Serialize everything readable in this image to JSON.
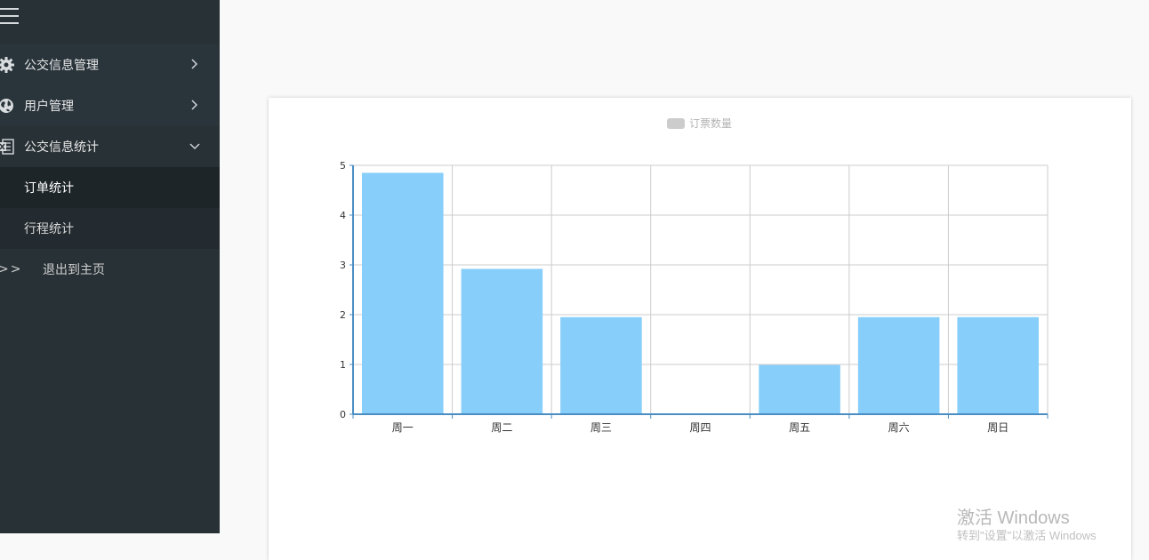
{
  "sidebar": {
    "items": [
      {
        "label": "公交信息管理",
        "icon": "gear-icon",
        "state": "collapsed"
      },
      {
        "label": "用户管理",
        "icon": "globe-icon",
        "state": "collapsed"
      },
      {
        "label": "公交信息统计",
        "icon": "excel-icon",
        "state": "expanded"
      }
    ],
    "sub_items": [
      {
        "label": "订单统计",
        "active": true
      },
      {
        "label": "行程统计",
        "active": false
      }
    ],
    "exit": {
      "arrows": ">>",
      "label": "退出到主页"
    }
  },
  "colors": {
    "sidebar_bg": "#283136",
    "bar": "#87cefa",
    "axis": "#4a8ec4"
  },
  "chart_data": {
    "type": "bar",
    "legend": [
      "订票数量"
    ],
    "categories": [
      "周一",
      "周二",
      "周三",
      "周四",
      "周五",
      "周六",
      "周日"
    ],
    "series": [
      {
        "name": "订票数量",
        "values": [
          4.85,
          2.92,
          1.95,
          0,
          0.99,
          1.95,
          1.95
        ]
      }
    ],
    "ylim": [
      0,
      5
    ],
    "yticks": [
      "0",
      "1",
      "2",
      "3",
      "4",
      "5"
    ],
    "grid": true,
    "legend_position": "top-center"
  },
  "watermark": {
    "title": "激活 Windows",
    "subtitle": "转到\"设置\"以激活 Windows"
  }
}
